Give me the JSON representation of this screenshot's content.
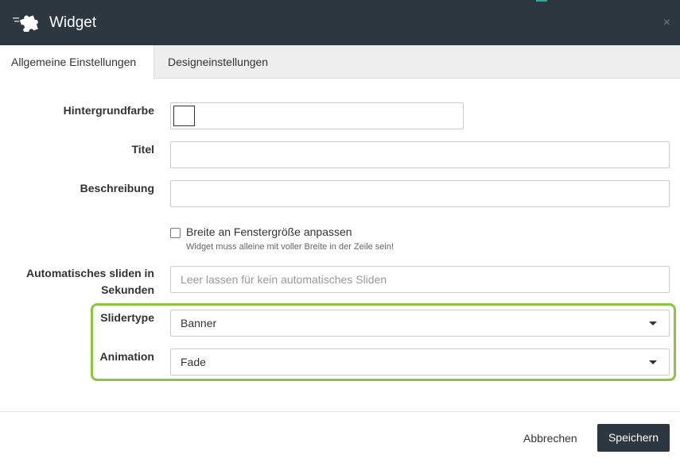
{
  "window": {
    "title": "Widget",
    "close_symbol": "×"
  },
  "tabs": [
    {
      "label": "Allgemeine Einstellungen",
      "active": true
    },
    {
      "label": "Designeinstellungen",
      "active": false
    }
  ],
  "form": {
    "background_color": {
      "label": "Hintergrundfarbe",
      "value": "#ffffff"
    },
    "title": {
      "label": "Titel",
      "value": ""
    },
    "description": {
      "label": "Beschreibung",
      "value": ""
    },
    "fit_width": {
      "label": "Breite an Fenstergröße anpassen",
      "help": "Widget muss alleine mit voller Breite in der Zeile sein!",
      "checked": false
    },
    "autoslide": {
      "label_line1": "Automatisches sliden in",
      "label_line2": "Sekunden",
      "placeholder": "Leer lassen für kein automatisches Sliden",
      "value": ""
    },
    "slidertype": {
      "label": "Slidertype",
      "value": "Banner"
    },
    "animation": {
      "label": "Animation",
      "value": "Fade"
    }
  },
  "footer": {
    "cancel_label": "Abbrechen",
    "save_label": "Speichern"
  },
  "colors": {
    "header_bg": "#2d3740",
    "highlight": "#8cc63f",
    "primary_button": "#2d3740"
  },
  "icons": {
    "logo": "puzzle-piece-icon",
    "close": "close-icon",
    "select_arrow": "caret-down-icon"
  }
}
